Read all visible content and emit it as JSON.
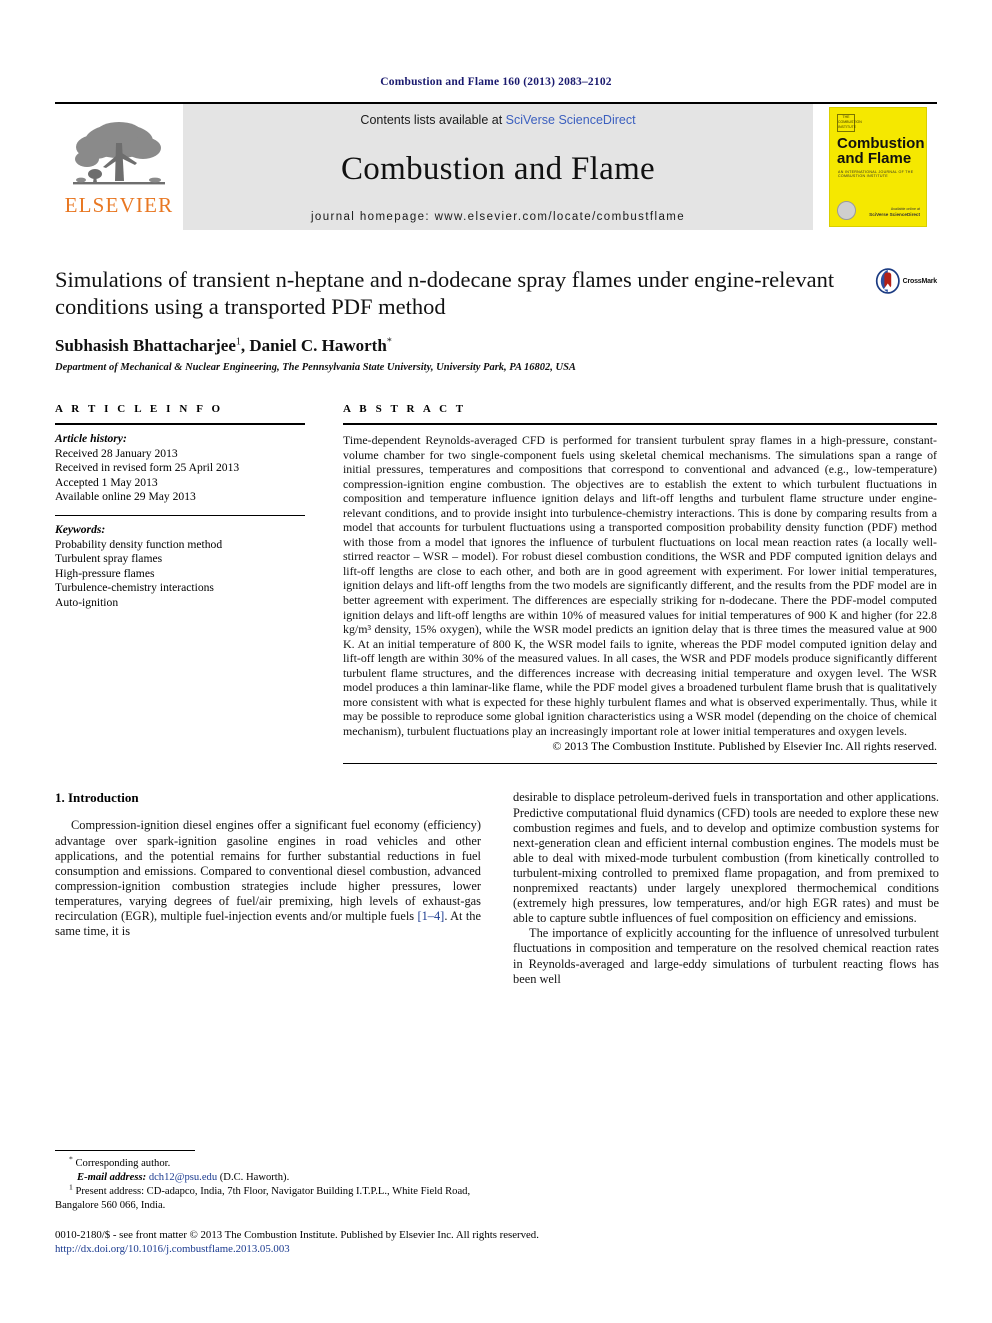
{
  "running_head": "Combustion and Flame 160 (2013) 2083–2102",
  "masthead": {
    "publisher_name": "ELSEVIER",
    "contents_prefix": "Contents lists available at ",
    "contents_link": "SciVerse ScienceDirect",
    "journal_title": "Combustion and Flame",
    "homepage": "journal homepage: www.elsevier.com/locate/combustflame",
    "cover": {
      "title": "Combustion and Flame",
      "subtitle": "AN INTERNATIONAL JOURNAL OF THE COMBUSTION INSTITUTE",
      "logo_text": "THE COMBUSTION INSTITUTE",
      "publisher_small": "Available online at",
      "publisher_bold": "SciVerse ScienceDirect"
    }
  },
  "article": {
    "title": "Simulations of transient n-heptane and n-dodecane spray flames under engine-relevant conditions using a transported PDF method",
    "crossmark_label": "CrossMark",
    "authors": "Subhasish Bhattacharjee",
    "author_marker_1": "1",
    "authors_2": ", Daniel C. Haworth",
    "author_marker_2": "*",
    "affiliation": "Department of Mechanical & Nuclear Engineering, The Pennsylvania State University, University Park, PA 16802, USA"
  },
  "info": {
    "heading": "A R T I C L E   I N F O",
    "history_label": "Article history:",
    "history": [
      "Received 28 January 2013",
      "Received in revised form 25 April 2013",
      "Accepted 1 May 2013",
      "Available online 29 May 2013"
    ],
    "keywords_label": "Keywords:",
    "keywords": [
      "Probability density function method",
      "Turbulent spray flames",
      "High-pressure flames",
      "Turbulence-chemistry interactions",
      "Auto-ignition"
    ]
  },
  "abstract": {
    "heading": "A B S T R A C T",
    "text": "Time-dependent Reynolds-averaged CFD is performed for transient turbulent spray flames in a high-pressure, constant-volume chamber for two single-component fuels using skeletal chemical mechanisms. The simulations span a range of initial pressures, temperatures and compositions that correspond to conventional and advanced (e.g., low-temperature) compression-ignition engine combustion. The objectives are to establish the extent to which turbulent fluctuations in composition and temperature influence ignition delays and lift-off lengths and turbulent flame structure under engine-relevant conditions, and to provide insight into turbulence-chemistry interactions. This is done by comparing results from a model that accounts for turbulent fluctuations using a transported composition probability density function (PDF) method with those from a model that ignores the influence of turbulent fluctuations on local mean reaction rates (a locally well-stirred reactor – WSR – model). For robust diesel combustion conditions, the WSR and PDF computed ignition delays and lift-off lengths are close to each other, and both are in good agreement with experiment. For lower initial temperatures, ignition delays and lift-off lengths from the two models are significantly different, and the results from the PDF model are in better agreement with experiment. The differences are especially striking for n-dodecane. There the PDF-model computed ignition delays and lift-off lengths are within 10% of measured values for initial temperatures of 900 K and higher (for 22.8 kg/m³ density, 15% oxygen), while the WSR model predicts an ignition delay that is three times the measured value at 900 K. At an initial temperature of 800 K, the WSR model fails to ignite, whereas the PDF model computed ignition delay and lift-off length are within 30% of the measured values. In all cases, the WSR and PDF models produce significantly different turbulent flame structures, and the differences increase with decreasing initial temperature and oxygen level. The WSR model produces a thin laminar-like flame, while the PDF model gives a broadened turbulent flame brush that is qualitatively more consistent with what is expected for these highly turbulent flames and what is observed experimentally. Thus, while it may be possible to reproduce some global ignition characteristics using a WSR model (depending on the choice of chemical mechanism), turbulent fluctuations play an increasingly important role at lower initial temperatures and oxygen levels.",
    "copyright": "© 2013 The Combustion Institute. Published by Elsevier Inc. All rights reserved."
  },
  "body": {
    "section_heading": "1. Introduction",
    "left_paragraph_1_a": "Compression-ignition diesel engines offer a significant fuel economy (efficiency) advantage over spark-ignition gasoline engines in road vehicles and other applications, and the potential remains for further substantial reductions in fuel consumption and emissions. Compared to conventional diesel combustion, advanced compression-ignition combustion strategies include higher pressures, lower temperatures, varying degrees of fuel/air premixing, high levels of exhaust-gas recirculation (EGR), multiple fuel-injection events and/or multiple fuels ",
    "left_citation": "[1–4]",
    "left_paragraph_1_b": ". At the same time, it is",
    "right_paragraph_1": "desirable to displace petroleum-derived fuels in transportation and other applications. Predictive computational fluid dynamics (CFD) tools are needed to explore these new combustion regimes and fuels, and to develop and optimize combustion systems for next-generation clean and efficient internal combustion engines. The models must be able to deal with mixed-mode turbulent combustion (from kinetically controlled to turbulent-mixing controlled to premixed flame propagation, and from premixed to nonpremixed reactants) under largely unexplored thermochemical conditions (extremely high pressures, low temperatures, and/or high EGR rates) and must be able to capture subtle influences of fuel composition on efficiency and emissions.",
    "right_paragraph_2": "The importance of explicitly accounting for the influence of unresolved turbulent fluctuations in composition and temperature on the resolved chemical reaction rates in Reynolds-averaged and large-eddy simulations of turbulent reacting flows has been well"
  },
  "footnotes": {
    "corresponding_marker": "*",
    "corresponding": "Corresponding author.",
    "email_label": "E-mail address:",
    "email": "dch12@psu.edu",
    "email_suffix": "(D.C. Haworth).",
    "present_marker": "1",
    "present_address": "Present address: CD-adapco, India, 7th Floor, Navigator Building I.T.P.L., White Field Road, Bangalore 560 066, India."
  },
  "imprint": {
    "line1": "0010-2180/$ - see front matter © 2013 The Combustion Institute. Published by Elsevier Inc. All rights reserved.",
    "doi": "http://dx.doi.org/10.1016/j.combustflame.2013.05.003"
  },
  "colors": {
    "link": "#3b5fbf",
    "elsevier_orange": "#E87722",
    "cover_yellow": "#f5e800",
    "band_gray": "#e4e4e4",
    "runhead_navy": "#1a1a6e"
  }
}
